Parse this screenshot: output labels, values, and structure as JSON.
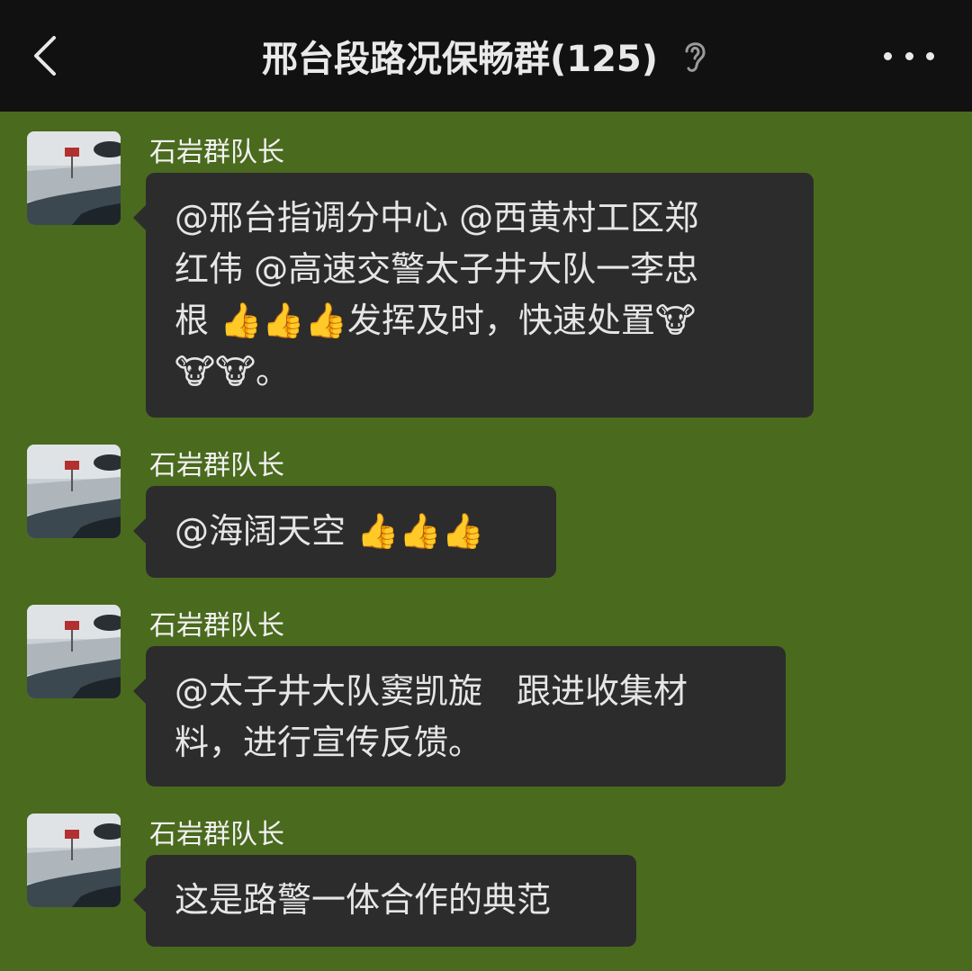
{
  "header": {
    "title": "邢台段路况保畅群(125)",
    "back_icon": "chevron-left-icon",
    "ear_icon": "ear-icon",
    "more_icon": "more-dots-icon"
  },
  "colors": {
    "header_bg": "#111111",
    "chat_bg": "#4a6a1e",
    "bubble_bg": "#2c2c2c",
    "text": "#e6e6e6"
  },
  "messages": [
    {
      "sender": "石岩群队长",
      "lines": [
        "@邢台指调分中心 @西黄村工区郑",
        "红伟 @高速交警太子井大队一李忠",
        "根 👍👍👍发挥及时，快速处置🐮",
        "🐮🐮。"
      ]
    },
    {
      "sender": "石岩群队长",
      "lines": [
        "@海阔天空 👍👍👍"
      ]
    },
    {
      "sender": "石岩群队长",
      "lines": [
        "@太子井大队窦凯旋　跟进收集材",
        "料，进行宣传反馈。"
      ]
    },
    {
      "sender": "石岩群队长",
      "lines": [
        "这是路警一体合作的典范"
      ]
    }
  ]
}
